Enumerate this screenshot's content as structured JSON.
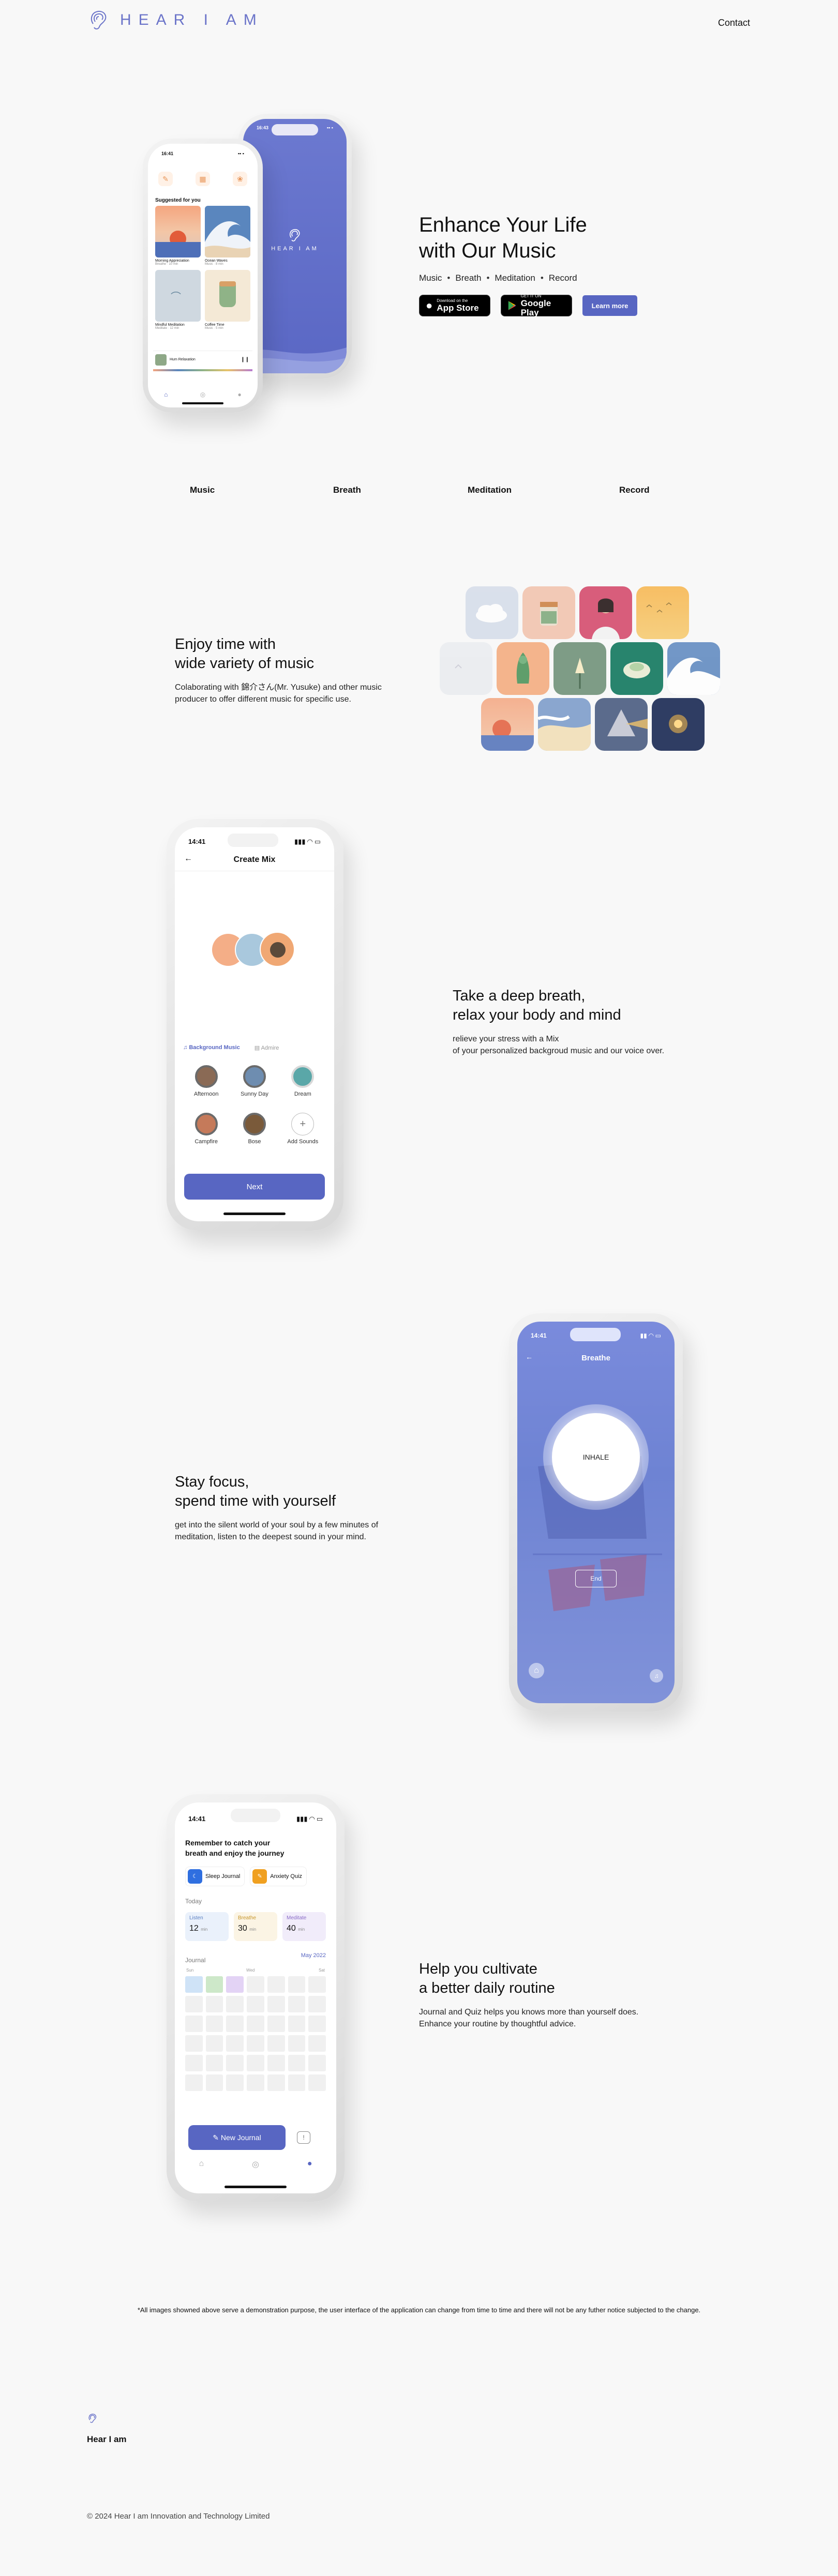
{
  "header": {
    "logo_text": "HEAR I AM",
    "contact_label": "Contact"
  },
  "hero": {
    "title_line1": "Enhance Your Life",
    "title_line2": "with Our Music",
    "tags": [
      "Music",
      "Breath",
      "Meditation",
      "Record"
    ],
    "app_store_small": "Download on the",
    "app_store_big": "App Store",
    "google_play_small": "GET IT ON",
    "google_play_big": "Google Play",
    "learn_more_label": "Learn more",
    "phone_left": {
      "time": "16:41",
      "suggested_label": "Suggested for you",
      "cards": [
        {
          "title": "Morning Appreciation",
          "sub": "Breathe · 10 min"
        },
        {
          "title": "Ocean Waves",
          "sub": "Music · 8 min"
        },
        {
          "title": "Mindful Meditation",
          "sub": "Meditate · 12 min"
        },
        {
          "title": "Coffee Time",
          "sub": "Music · 5 min"
        }
      ],
      "now_playing": "Hum Relaxation"
    },
    "phone_right": {
      "time": "16:43",
      "logo_text": "HEAR I AM"
    }
  },
  "feature_nav": [
    "Music",
    "Breath",
    "Meditation",
    "Record"
  ],
  "music_section": {
    "title_line1": "Enjoy time with",
    "title_line2": "wide variety of music",
    "desc_line1": "Colaborating with 錦介さん(Mr. Yusuke) and other music",
    "desc_line2": "producer to offer different music for specific use."
  },
  "breath_section": {
    "title_line1": "Take a deep breath,",
    "title_line2": "relax your body and mind",
    "desc_line1": "relieve your stress with a Mix",
    "desc_line2": "of your personalized backgroud music and our voice over.",
    "phone": {
      "time": "14:41",
      "screen_title": "Create Mix",
      "tab_background": "Background Music",
      "tab_asmr": "Admire",
      "sounds": [
        "Afternoon",
        "Sunny Day",
        "Dream",
        "Campfire",
        "Bose",
        "Add Sounds"
      ],
      "next_label": "Next"
    }
  },
  "meditation_section": {
    "title_line1": "Stay focus,",
    "title_line2": "spend time with yourself",
    "desc_line1": "get into the silent world of your soul by a few minutes of",
    "desc_line2": "meditation, listen to the deepest sound in your mind.",
    "phone": {
      "time": "14:41",
      "screen_title": "Breathe",
      "inhale_label": "INHALE",
      "end_label": "End"
    }
  },
  "record_section": {
    "title_line1": "Help you cultivate",
    "title_line2": "a better daily routine",
    "desc_line1": "Journal and Quiz helps you knows more than yourself does.",
    "desc_line2": "Enhance your routine by thoughtful advice.",
    "phone": {
      "time": "14:41",
      "headline_line1": "Remember to catch your",
      "headline_line2": "breath and enjoy the journey",
      "chip_sleep": "Sleep Journal",
      "chip_anxiety": "Anxiety Quiz",
      "today_label": "Today",
      "stats": [
        {
          "label": "Listen",
          "value": "12",
          "unit": "min"
        },
        {
          "label": "Breathe",
          "value": "30",
          "unit": "min"
        },
        {
          "label": "Meditate",
          "value": "40",
          "unit": "min"
        }
      ],
      "journal_label": "Journal",
      "month_label": "May 2022",
      "weekday_labels": [
        "Sun",
        "Wed",
        "Sat"
      ],
      "new_journal_label": "New Journal"
    }
  },
  "disclaimer": "*All images showned above serve a demonstration purpose, the user interface of the application can change from time to time and there will not be any futher notice subjected to the change.",
  "footer": {
    "name": "Hear I am",
    "copyright": "© 2024 Hear I am Innovation and Technology Limited"
  },
  "colors": {
    "brand": "#5866c2",
    "brand_light": "#6b74c9",
    "background": "#f8f8f8"
  }
}
